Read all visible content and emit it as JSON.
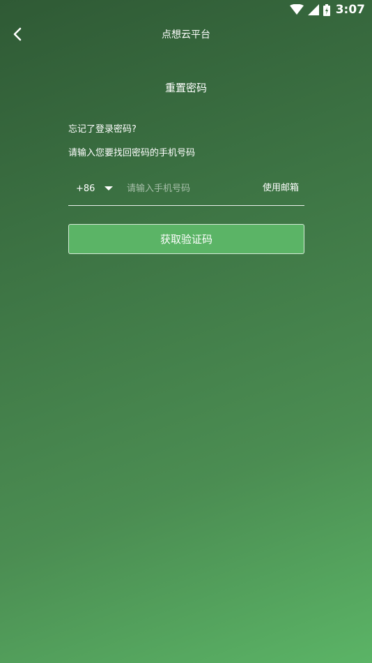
{
  "status_bar": {
    "time": "3:07",
    "icons": [
      "wifi-icon",
      "cellular-signal-icon",
      "battery-icon"
    ]
  },
  "app_bar": {
    "title": "点想云平台",
    "back_icon": "chevron-left-icon"
  },
  "page": {
    "title": "重置密码",
    "prompt_line1": "忘记了登录密码?",
    "prompt_line2": "请输入您要找回密码的手机号码"
  },
  "phone_form": {
    "country_code": "+86",
    "dropdown_icon": "caret-down-icon",
    "phone_value": "",
    "phone_placeholder": "请输入手机号码",
    "use_email_label": "使用邮箱"
  },
  "actions": {
    "get_code_label": "获取验证码"
  },
  "colors": {
    "background_top": "#2f5a35",
    "background_bottom": "#5bb466",
    "button": "#5bb466",
    "text": "#ffffff"
  }
}
